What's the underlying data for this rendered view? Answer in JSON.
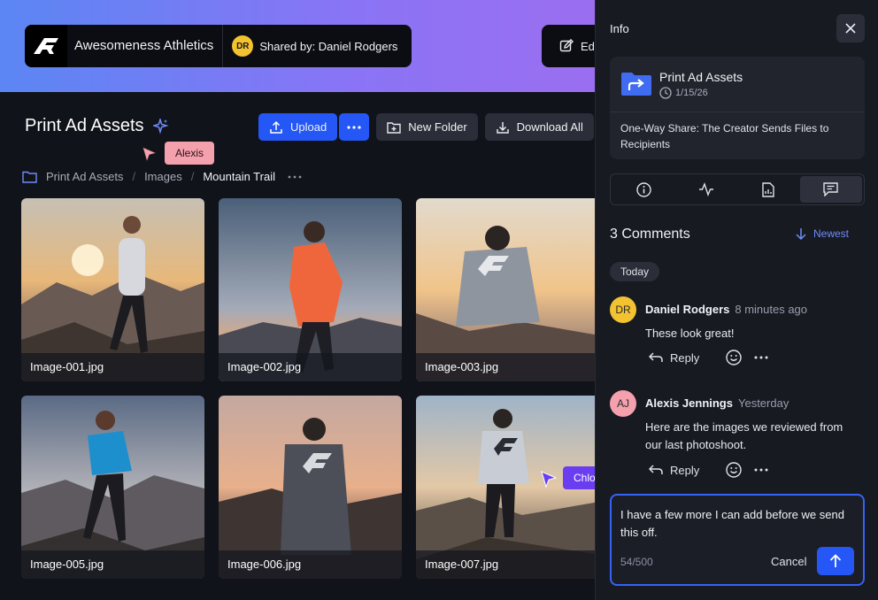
{
  "header": {
    "brand_name": "Awesomeness Athletics",
    "shared_avatar": "DR",
    "shared_by": "Shared by: Daniel Rodgers",
    "edit_label": "Edit"
  },
  "main": {
    "title": "Print Ad Assets",
    "toolbar": {
      "upload": "Upload",
      "new_folder": "New Folder",
      "download_all": "Download All"
    },
    "breadcrumbs": [
      "Print Ad Assets",
      "Images",
      "Mountain Trail"
    ],
    "images": [
      {
        "name": "Image-001.jpg"
      },
      {
        "name": "Image-002.jpg"
      },
      {
        "name": "Image-003.jpg"
      },
      {
        "name": "Image-005.jpg"
      },
      {
        "name": "Image-006.jpg"
      },
      {
        "name": "Image-007.jpg"
      }
    ],
    "cursors": {
      "alexis": "Alexis",
      "chloe": "Chloe"
    }
  },
  "panel": {
    "title": "Info",
    "card": {
      "name": "Print Ad Assets",
      "date": "1/15/26",
      "description": "One-Way Share: The Creator Sends Files to Recipients"
    },
    "comments_header": "3 Comments",
    "sort_label": "Newest",
    "day_label": "Today",
    "comments": [
      {
        "initials": "DR",
        "author": "Daniel Rodgers",
        "time": "8 minutes ago",
        "text": "These look great!",
        "reply": "Reply"
      },
      {
        "initials": "AJ",
        "author": "Alexis Jennings",
        "time": "Yesterday",
        "text": "Here are the images we reviewed from our last photoshoot.",
        "reply": "Reply"
      }
    ],
    "composer": {
      "text": "I have a few more I can add before we send this off.",
      "count": "54/500",
      "cancel": "Cancel"
    }
  },
  "colors": {
    "accent": "#2457f5",
    "dr_avatar": "#f2c230",
    "aj_avatar": "#f4a0ad",
    "chloe": "#6a3df0"
  }
}
